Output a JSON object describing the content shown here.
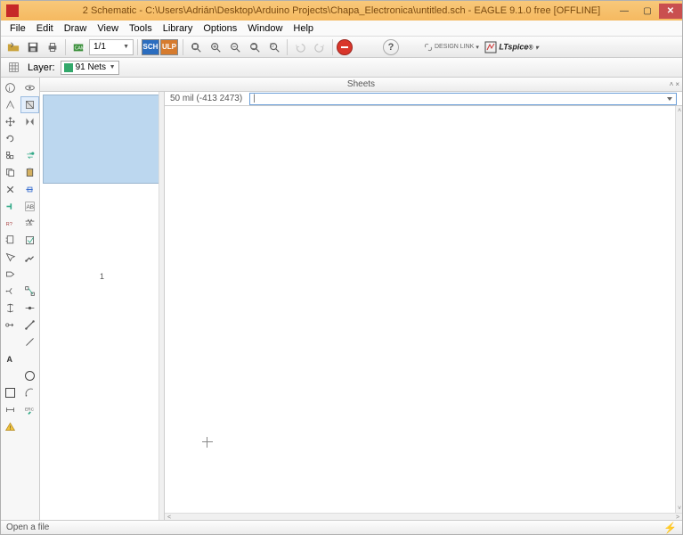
{
  "title": "2 Schematic - C:\\Users\\Adrián\\Desktop\\Arduino Projects\\Chapa_Electronica\\untitled.sch - EAGLE 9.1.0 free [OFFLINE]",
  "menu": [
    "File",
    "Edit",
    "Draw",
    "View",
    "Tools",
    "Library",
    "Options",
    "Window",
    "Help"
  ],
  "toolbar": {
    "sheet_value": "1/1",
    "mode_sch": "SCH",
    "mode_brd": "ULP",
    "design_link": "DESIGN LINK",
    "spice": "LTspice"
  },
  "layerbar": {
    "label": "Layer:",
    "value": "91 Nets"
  },
  "sheets": {
    "header": "Sheets",
    "page_label": "1"
  },
  "coords": "50 mil (-413 2473)",
  "command_value": "|",
  "status": "Open a file",
  "icons": {
    "magnify": "zoom",
    "help": "?"
  }
}
